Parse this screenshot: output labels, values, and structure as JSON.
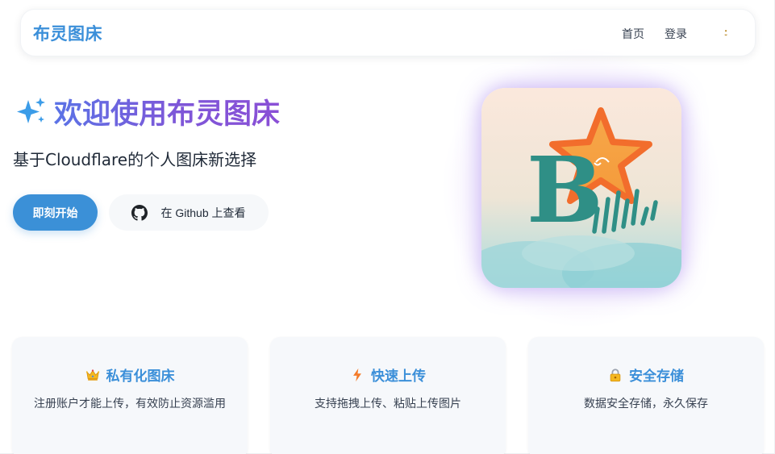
{
  "navbar": {
    "brand": "布灵图床",
    "links": [
      {
        "label": "首页"
      },
      {
        "label": "登录"
      }
    ],
    "theme_icon": "moon-icon"
  },
  "hero": {
    "title_icon": "sparkle-icon",
    "title": "欢迎使用布灵图床",
    "subtitle": "基于Cloudflare的个人图床新选择",
    "primary_button": "即刻开始",
    "github_button": "在 Github 上查看",
    "github_icon": "github-icon",
    "logo_letter": "B"
  },
  "features": [
    {
      "icon": "crown-icon",
      "title": "私有化图床",
      "description": "注册账户才能上传，有效防止资源滥用"
    },
    {
      "icon": "lightning-icon",
      "title": "快速上传",
      "description": "支持拖拽上传、粘贴上传图片"
    },
    {
      "icon": "lock-icon",
      "title": "安全存储",
      "description": "数据安全存储，永久保存"
    }
  ],
  "colors": {
    "accent": "#3b8fd9",
    "gradient_start": "#5b73e6",
    "gradient_end": "#8a4fd6",
    "card_bg": "#f6f8fb"
  }
}
